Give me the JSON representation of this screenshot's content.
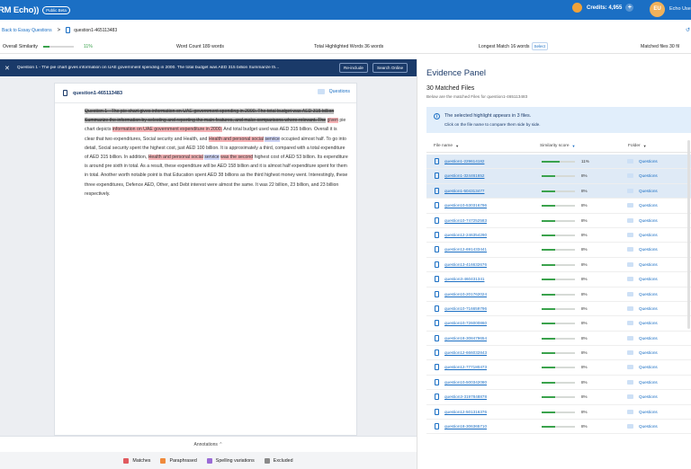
{
  "header": {
    "logo": "RM Echo))",
    "badge": "Public Beta",
    "credits_label": "Credits: 4,955",
    "plus": "+",
    "avatar_initials": "EU",
    "user_name": "Echo Use"
  },
  "breadcrumb": {
    "back_label": "Back to Essay Questions",
    "separator": ">",
    "current": "question1-465113483",
    "right_icon": "↺"
  },
  "stats": {
    "similarity_label": "Overall Similarity",
    "similarity_value": "11%",
    "similarity_fraction": 0.11,
    "word_count": "Word Count 189 words",
    "total_highlighted": "Total Highlighted Words 36 words",
    "longest_match": "Longest Match 16 words",
    "select_label": "Select",
    "matched_files": "Matched files 30 fil"
  },
  "question_bar": {
    "close": "✕",
    "text": "Question 1 - The pie chart gives information on UAE government spending in 2000. The total budget was AED 315 billion Summarize th...",
    "reinclude": "Re-include",
    "search_online": "Search Online"
  },
  "document": {
    "title": "question1-465113483",
    "questions_tag": "Questions",
    "segments": [
      {
        "t": "Question 1 - The pie chart gives information on UAE government spending in 2000. The total budget was AED 315 billion Summarize the information by selecting and reporting the main features, and make comparisons where relevant. The",
        "c": "hl-gray strike"
      },
      {
        "t": " ",
        "c": ""
      },
      {
        "t": "given",
        "c": "hl-red"
      },
      {
        "t": " pie chart depicts ",
        "c": ""
      },
      {
        "t": "information on UAE government expenditure in 2000.",
        "c": "hl-red"
      },
      {
        "t": " And total budget used was AED 315 billion. Overall it is clear that two expenditures, Social security and Health, and ",
        "c": ""
      },
      {
        "t": "Health and personal social",
        "c": "hl-red"
      },
      {
        "t": " ",
        "c": ""
      },
      {
        "t": "service",
        "c": "hl-blue"
      },
      {
        "t": " occupied almost half. To go into detail, Social security spent the highest cost, just AED 100 billion. It is approximately a third, compared with a total expenditure of AED 315 billion. In addition, ",
        "c": ""
      },
      {
        "t": "Health and personal social",
        "c": "hl-red"
      },
      {
        "t": " ",
        "c": ""
      },
      {
        "t": "service",
        "c": "hl-blue"
      },
      {
        "t": " ",
        "c": ""
      },
      {
        "t": "was the second",
        "c": "hl-red"
      },
      {
        "t": " highest cost of AED 53 billion. Its expenditure is around pre sixth in total. As a result, these expenditure will be AED 158 billion and it is almost half expenditure spent for them in total. Another worth notable point is that Education spent AED 38 billions as the third highest money went. Interestingly, these three expenditures, Defence AED, Other, and Debt interest were almost the same. It was 22 billion, 23 billion, and 23 billion respectively.",
        "c": ""
      }
    ],
    "annotations_label": "Annotations  ⌃"
  },
  "legend": [
    {
      "label": "Matches",
      "color": "#e05a5f"
    },
    {
      "label": "Paraphrased",
      "color": "#ef8a3c"
    },
    {
      "label": "Spelling variations",
      "color": "#9a6bd6"
    },
    {
      "label": "Excluded",
      "color": "#8a8a8a"
    }
  ],
  "evidence": {
    "title": "Evidence Panel",
    "count": "30 Matched Files",
    "subtitle": "Below are the matched Files for question1-465113483",
    "info_title": "The selected highlight appears in 3 files.",
    "info_sub": "Click on the file name to compare them side by side.",
    "col_file": "File name",
    "col_score": "Similarity score",
    "col_folder": "Folder",
    "sort_caret": "▼",
    "rows": [
      {
        "name": "question1-229614182",
        "score": "11%",
        "fraction": 0.11,
        "folder": "Questions",
        "selected": true
      },
      {
        "name": "question1-324461652",
        "score": "8%",
        "fraction": 0.08,
        "folder": "Questions",
        "selected": true
      },
      {
        "name": "question1-504313477",
        "score": "8%",
        "fraction": 0.08,
        "folder": "Questions",
        "selected": true
      },
      {
        "name": "question10-530316796",
        "score": "8%",
        "fraction": 0.08,
        "folder": "Questions",
        "selected": false
      },
      {
        "name": "question10-747252583",
        "score": "8%",
        "fraction": 0.08,
        "folder": "Questions",
        "selected": false
      },
      {
        "name": "question12-246354290",
        "score": "8%",
        "fraction": 0.08,
        "folder": "Questions",
        "selected": false
      },
      {
        "name": "question12-691433441",
        "score": "8%",
        "fraction": 0.08,
        "folder": "Questions",
        "selected": false
      },
      {
        "name": "question13-416632676",
        "score": "8%",
        "fraction": 0.08,
        "folder": "Questions",
        "selected": false
      },
      {
        "name": "question3-460431341",
        "score": "8%",
        "fraction": 0.08,
        "folder": "Questions",
        "selected": false
      },
      {
        "name": "question10-201762024",
        "score": "8%",
        "fraction": 0.08,
        "folder": "Questions",
        "selected": false
      },
      {
        "name": "question10-716659796",
        "score": "8%",
        "fraction": 0.08,
        "folder": "Questions",
        "selected": false
      },
      {
        "name": "question10-726000860",
        "score": "8%",
        "fraction": 0.08,
        "folder": "Questions",
        "selected": false
      },
      {
        "name": "question18-308479654",
        "score": "8%",
        "fraction": 0.08,
        "folder": "Questions",
        "selected": false
      },
      {
        "name": "question12-666032843",
        "score": "8%",
        "fraction": 0.08,
        "folder": "Questions",
        "selected": false
      },
      {
        "name": "question12-777180473",
        "score": "8%",
        "fraction": 0.08,
        "folder": "Questions",
        "selected": false
      },
      {
        "name": "question10-500342080",
        "score": "8%",
        "fraction": 0.08,
        "folder": "Questions",
        "selected": false
      },
      {
        "name": "question3-3197848878",
        "score": "8%",
        "fraction": 0.08,
        "folder": "Questions",
        "selected": false
      },
      {
        "name": "question12-501316376",
        "score": "8%",
        "fraction": 0.08,
        "folder": "Questions",
        "selected": false
      },
      {
        "name": "question18-306365710",
        "score": "8%",
        "fraction": 0.08,
        "folder": "Questions",
        "selected": false
      }
    ]
  }
}
